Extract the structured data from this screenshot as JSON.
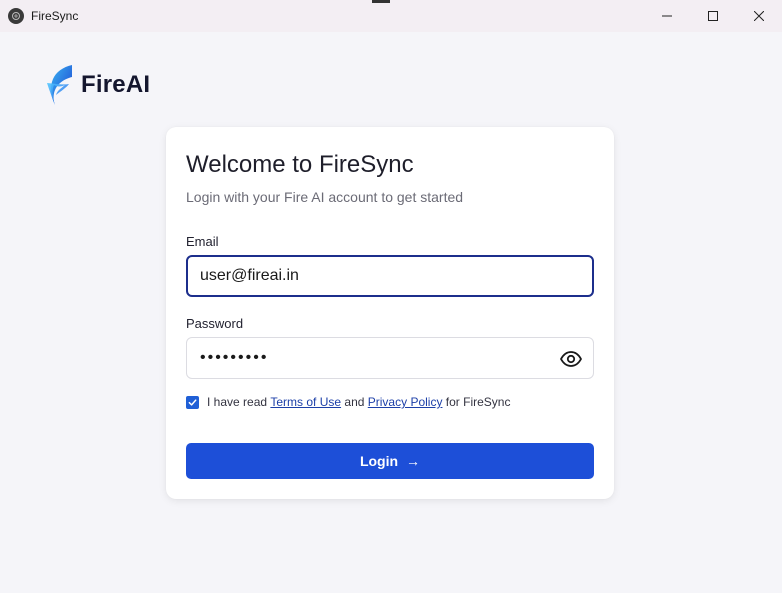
{
  "window": {
    "title": "FireSync"
  },
  "logo": {
    "text": "FireAI"
  },
  "card": {
    "title": "Welcome to FireSync",
    "subtitle": "Login with your Fire AI account to get started"
  },
  "form": {
    "email_label": "Email",
    "email_value": "user@fireai.in",
    "password_label": "Password",
    "password_value": "•••••••••",
    "terms_prefix": "I have read ",
    "terms_link": "Terms of Use",
    "terms_and": " and ",
    "privacy_link": "Privacy Policy",
    "terms_suffix": " for FireSync",
    "terms_checked": true,
    "login_label": "Login",
    "login_arrow": "→"
  },
  "colors": {
    "accent": "#1d4fd8",
    "focus_border": "#1c2e8c",
    "checkbox": "#1f5fd6",
    "link": "#1c3fa8"
  }
}
